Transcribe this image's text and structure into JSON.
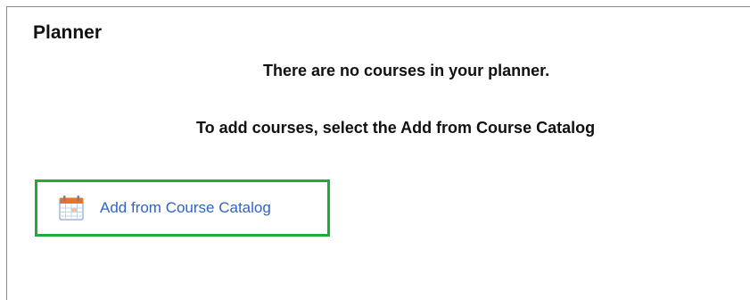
{
  "planner": {
    "title": "Planner",
    "empty_message": "There are no courses in your planner.",
    "instruction": "To add courses, select the Add from Course Catalog",
    "add_link": {
      "label": "Add from Course Catalog",
      "icon": "calendar-icon"
    }
  },
  "colors": {
    "link": "#2f64c8",
    "highlight": "#1faa3a",
    "icon_accent": "#e8742a"
  }
}
